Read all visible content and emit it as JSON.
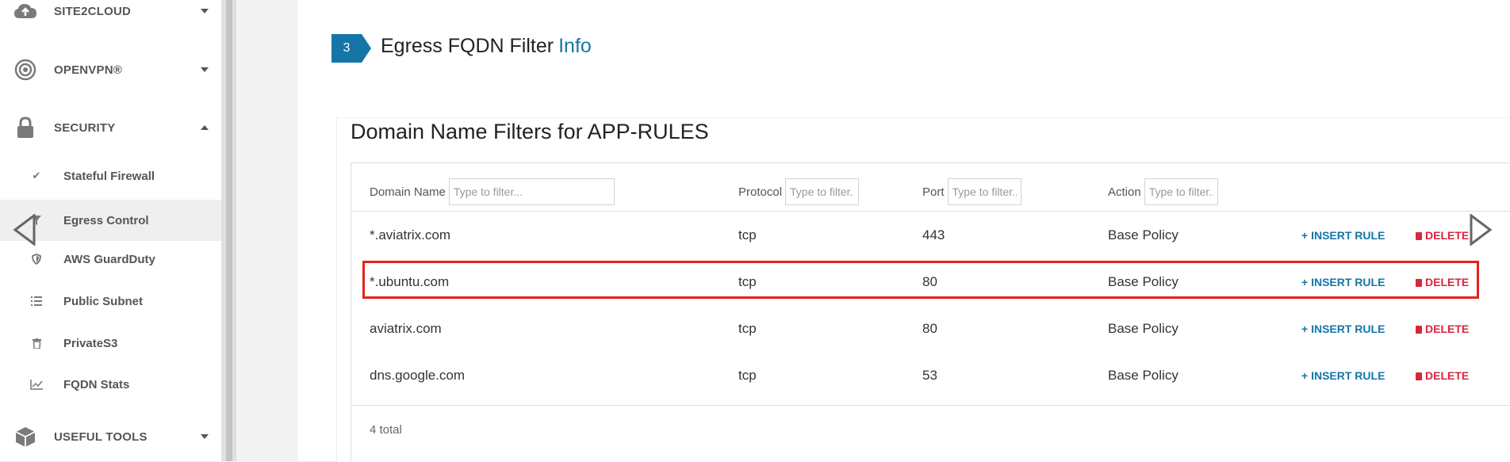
{
  "sidebar": {
    "sections": [
      {
        "label": "SITE2CLOUD",
        "icon": "cloud-upload-icon",
        "expanded": false
      },
      {
        "label": "OPENVPN®",
        "icon": "openvpn-icon",
        "expanded": false
      },
      {
        "label": "SECURITY",
        "icon": "lock-icon",
        "expanded": true
      },
      {
        "label": "USEFUL TOOLS",
        "icon": "cube-icon",
        "expanded": false
      }
    ],
    "security_items": [
      {
        "label": "Stateful Firewall",
        "icon": "check-icon"
      },
      {
        "label": "Egress Control",
        "icon": "filter-icon",
        "active": true
      },
      {
        "label": "AWS GuardDuty",
        "icon": "shield-icon"
      },
      {
        "label": "Public Subnet",
        "icon": "list-icon"
      },
      {
        "label": "PrivateS3",
        "icon": "trash-icon"
      },
      {
        "label": "FQDN Stats",
        "icon": "line-chart-icon"
      }
    ]
  },
  "step": {
    "number": "3",
    "title": "Egress FQDN Filter",
    "info_link": "Info"
  },
  "card": {
    "title": "Domain Name Filters for APP-RULES"
  },
  "table": {
    "columns": [
      {
        "label": "Domain Name",
        "placeholder": "Type to filter..."
      },
      {
        "label": "Protocol",
        "placeholder": "Type to filter..."
      },
      {
        "label": "Port",
        "placeholder": "Type to filter..."
      },
      {
        "label": "Action",
        "placeholder": "Type to filter..."
      }
    ],
    "rows": [
      {
        "domain": "*.aviatrix.com",
        "protocol": "tcp",
        "port": "443",
        "action": "Base Policy"
      },
      {
        "domain": "*.ubuntu.com",
        "protocol": "tcp",
        "port": "80",
        "action": "Base Policy"
      },
      {
        "domain": "aviatrix.com",
        "protocol": "tcp",
        "port": "80",
        "action": "Base Policy"
      },
      {
        "domain": "dns.google.com",
        "protocol": "tcp",
        "port": "53",
        "action": "Base Policy"
      }
    ],
    "insert_label": "+ INSERT RULE",
    "delete_label": "DELETE",
    "total": "4 total"
  },
  "colors": {
    "accent": "#1675a7",
    "danger": "#d7263d",
    "highlight": "#e5221a"
  }
}
